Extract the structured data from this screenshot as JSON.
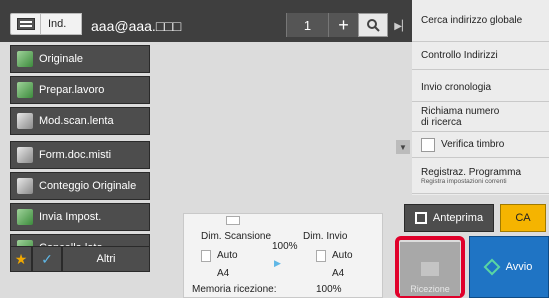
{
  "header": {
    "address_type": "Ind.",
    "address_value": "aaa@aaa.□□□",
    "count": "1",
    "plus_label": "+"
  },
  "left_menu": {
    "items": [
      {
        "label": "Originale",
        "icon": "original-document-icon"
      },
      {
        "label": "Prepar.lavoro",
        "icon": "job-prep-icon"
      },
      {
        "label": "Mod.scan.lenta",
        "icon": "slow-scan-icon"
      },
      {
        "label": "Form.doc.misti",
        "icon": "mixed-size-icon"
      },
      {
        "label": "Conteggio Originale",
        "icon": "original-count-icon"
      },
      {
        "label": "Invia Impost.",
        "icon": "send-settings-icon"
      },
      {
        "label": "Cancella lato",
        "icon": "erase-side-icon"
      }
    ],
    "altri_label": "Altri"
  },
  "right_menu": {
    "items": [
      {
        "label": "Cerca indirizzo globale"
      },
      {
        "label": "Controllo Indirizzi"
      },
      {
        "label": "Invio cronologia"
      },
      {
        "label": "Richiama numero\ndi ricerca"
      },
      {
        "label": "Verifica timbro"
      },
      {
        "label": "Registraz. Programma",
        "sub": "Registra impostazioni correnti"
      }
    ]
  },
  "info": {
    "scan_label": "Dim. Scansione",
    "scan_mode": "Auto",
    "scan_size": "A4",
    "ratio": "100%",
    "send_label": "Dim. Invio",
    "send_mode": "Auto",
    "send_size": "A4",
    "memory_label": "Memoria ricezione:",
    "memory_value": "100%"
  },
  "actions": {
    "anteprima": "Anteprima",
    "ca": "CA",
    "ricezione": "Ricezione",
    "avvio": "Avvio"
  },
  "colors": {
    "accent_start": "#1f74c4",
    "highlight": "#e0002a",
    "ca_yellow": "#f5b400"
  }
}
